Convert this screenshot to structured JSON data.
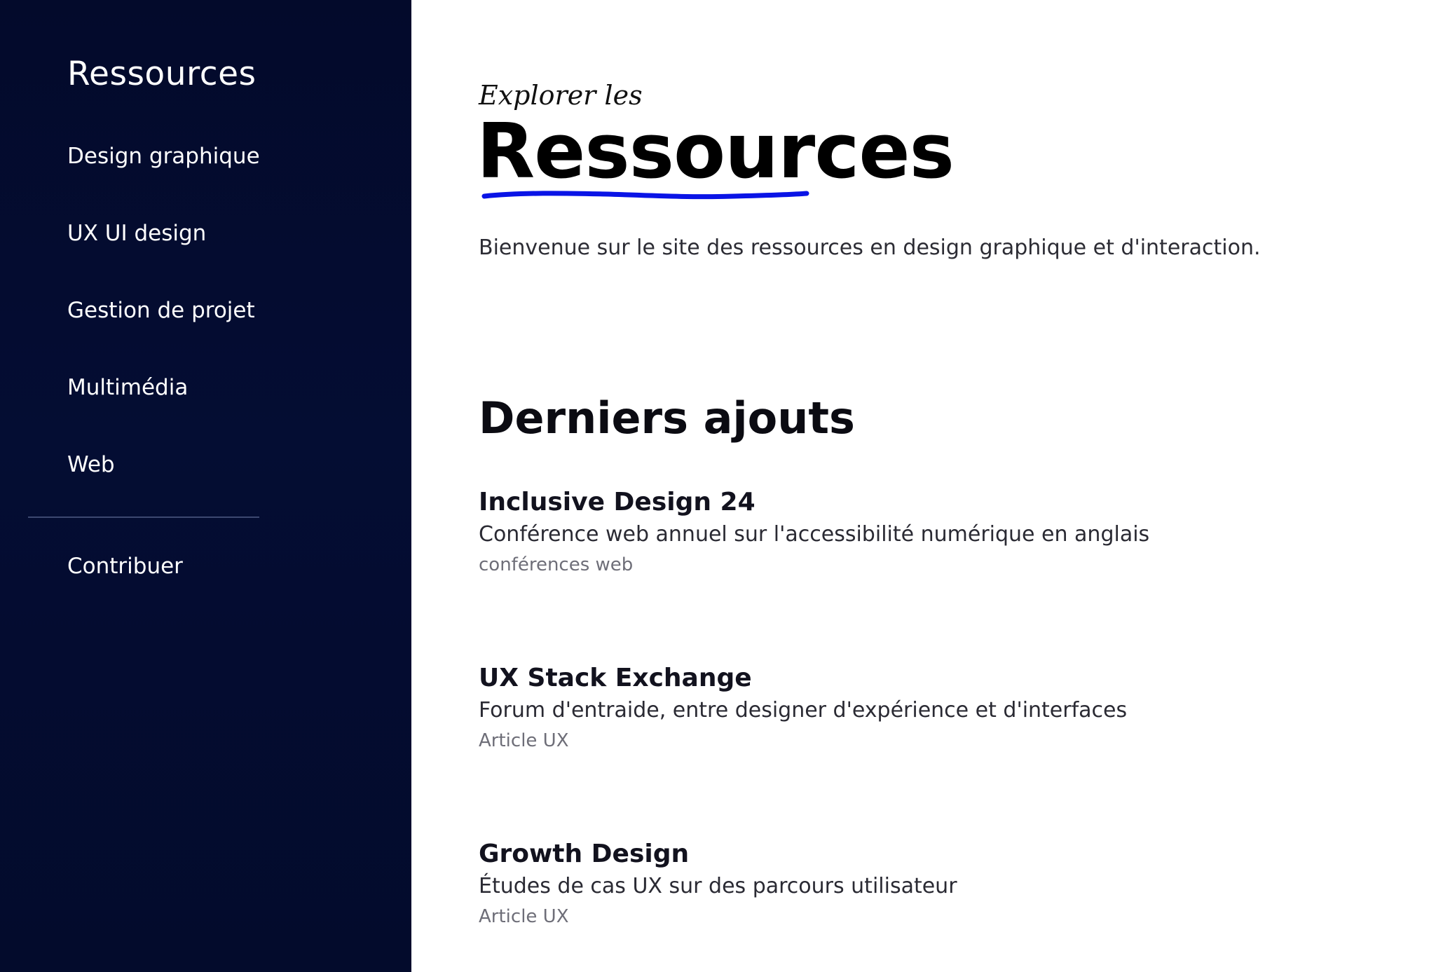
{
  "sidebar": {
    "title": "Ressources",
    "items": [
      {
        "label": "Design graphique"
      },
      {
        "label": "UX UI design"
      },
      {
        "label": "Gestion de projet"
      },
      {
        "label": "Multimédia"
      },
      {
        "label": "Web"
      }
    ],
    "contribute_label": "Contribuer"
  },
  "hero": {
    "eyebrow": "Explorer les",
    "title": "Ressources",
    "intro": "Bienvenue sur le site des ressources en design graphique et d'interaction."
  },
  "latest": {
    "heading": "Derniers ajouts",
    "items": [
      {
        "title": "Inclusive Design 24",
        "description": "Conférence web annuel sur l'accessibilité numérique en anglais",
        "tag": "conférences web"
      },
      {
        "title": "UX Stack Exchange",
        "description": "Forum d'entraide, entre designer d'expérience et d'interfaces",
        "tag": "Article UX"
      },
      {
        "title": "Growth Design",
        "description": "Études de cas UX sur des parcours utilisateur",
        "tag": "Article UX"
      }
    ]
  },
  "colors": {
    "sidebar_bg": "#040d33",
    "accent_underline": "#0a14e6",
    "text_dark": "#000000",
    "text_muted": "#6e6e78"
  }
}
